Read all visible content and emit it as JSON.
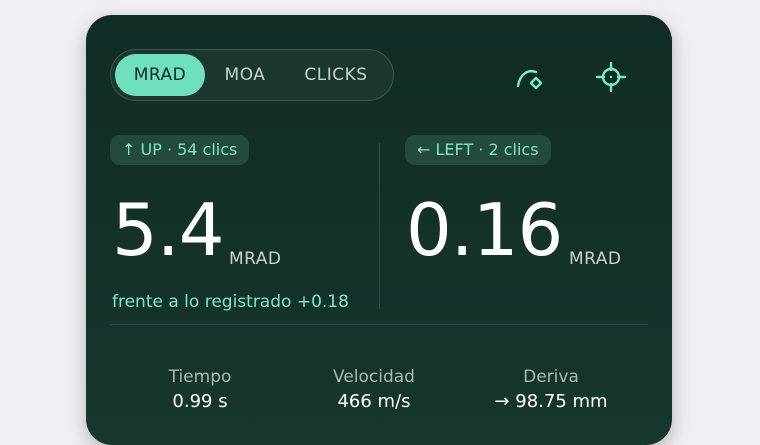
{
  "units_toggle": {
    "options": [
      "MRAD",
      "MOA",
      "CLICKS"
    ],
    "selected": "MRAD"
  },
  "colors": {
    "accent": "#6fe0be",
    "card_bg": "#14322a",
    "page_bg": "#f0eff4"
  },
  "icons": {
    "range": "range-arc-icon",
    "target": "crosshair-icon"
  },
  "elevation": {
    "chip_arrow": "↑",
    "chip_text": "UP · 54 clics",
    "value": "5.4",
    "unit": "MRAD",
    "delta_text": "frente a lo registrado +0.18"
  },
  "windage": {
    "chip_arrow": "←",
    "chip_text": "LEFT · 2 clics",
    "value": "0.16",
    "unit": "MRAD"
  },
  "stats": {
    "time": {
      "label": "Tiempo",
      "value": "0.99 s"
    },
    "velocity": {
      "label": "Velocidad",
      "value": "466 m/s"
    },
    "drift": {
      "label": "Deriva",
      "arrow": "→",
      "value": "98.75 mm"
    }
  }
}
